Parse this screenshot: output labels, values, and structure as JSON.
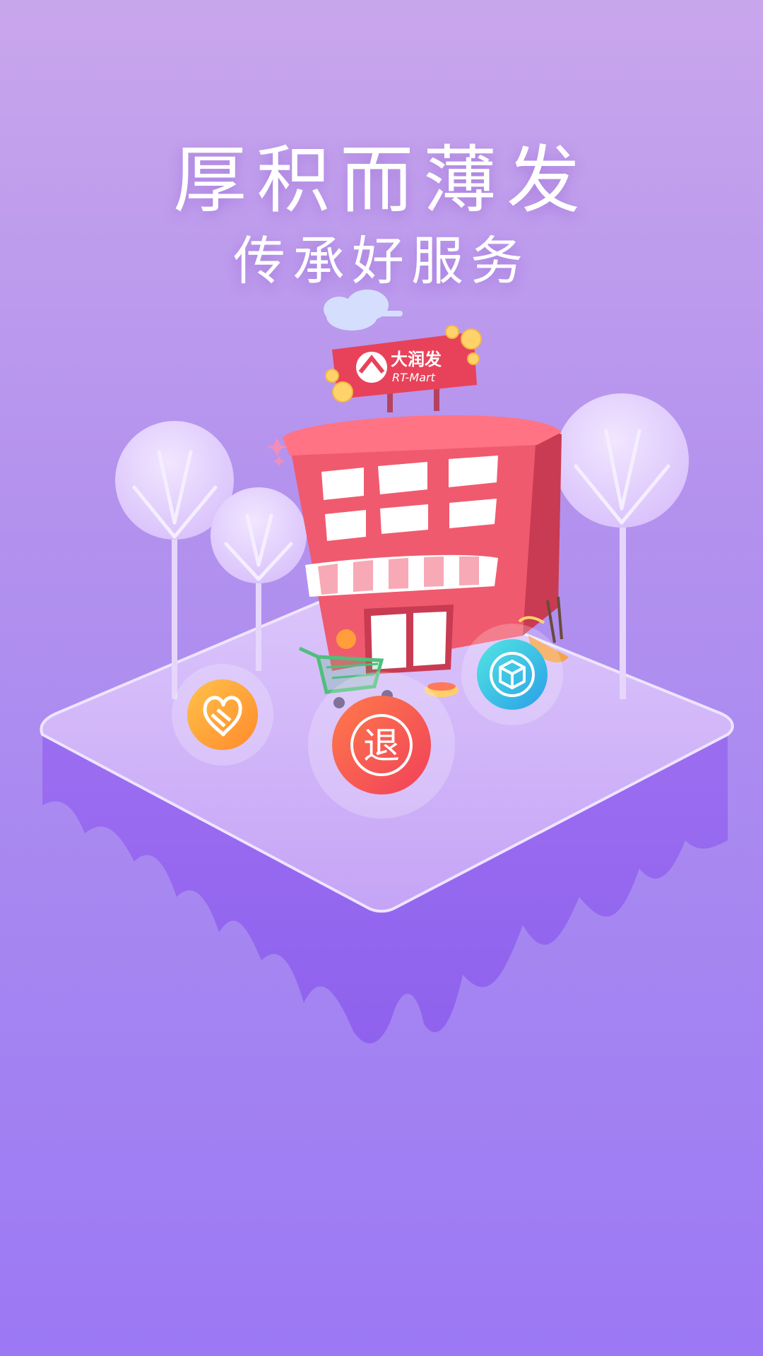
{
  "headline": {
    "main": "厚积而薄发",
    "sub": "传承好服务"
  },
  "store": {
    "brand_cn": "大润发",
    "brand_en": "RT-Mart"
  },
  "badges": {
    "return_label": "退"
  },
  "colors": {
    "bg_top": "#c9a6ec",
    "bg_bottom": "#9c78f4",
    "building": "#f05a6e",
    "sign": "#e8425a",
    "badge_orange": "#ffa43a",
    "badge_red": "#f45c4c",
    "badge_cyan": "#35cbe6"
  }
}
